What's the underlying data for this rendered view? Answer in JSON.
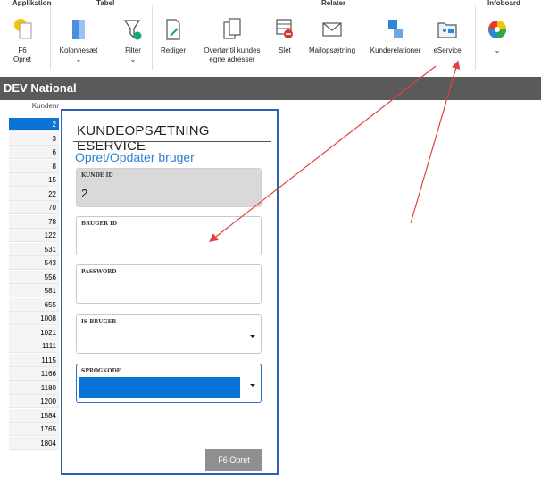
{
  "ribbon": {
    "groups": [
      "Applikation",
      "Tabel",
      "Relater",
      "Infoboard"
    ],
    "buttons": [
      {
        "label": "F6\nOpret",
        "icon": "lightbulb-icon"
      },
      {
        "label": "Kolonnesæt\n⌄",
        "icon": "columns-icon"
      },
      {
        "label": "Filter\n⌄",
        "icon": "filter-icon"
      },
      {
        "label": "Rediger",
        "icon": "edit-document-icon"
      },
      {
        "label": "Overfør til kundes\negne adresser",
        "icon": "copy-document-icon"
      },
      {
        "label": "Slet",
        "icon": "delete-table-icon"
      },
      {
        "label": "Mailopsætning",
        "icon": "envelope-icon"
      },
      {
        "label": "Kunderelationer",
        "icon": "relations-icon"
      },
      {
        "label": "eService",
        "icon": "eservice-folder-icon"
      },
      {
        "label": "⌄",
        "icon": "color-wheel-icon"
      }
    ]
  },
  "titlebar": {
    "title": "DEV National"
  },
  "grid": {
    "column_header": "Kundenr",
    "rows": [
      "2",
      "3",
      "6",
      "8",
      "15",
      "22",
      "70",
      "78",
      "122",
      "531",
      "543",
      "556",
      "581",
      "655",
      "1008",
      "1021",
      "1111",
      "1115",
      "1166",
      "1180",
      "1200",
      "1584",
      "1765",
      "1804"
    ]
  },
  "dialog": {
    "title": "KUNDEOPSÆTNING ESERVICE",
    "subtitle": "Opret/Opdater bruger",
    "fields": {
      "kunde_id": {
        "label": "KUNDE ID",
        "value": "2"
      },
      "bruger_id": {
        "label": "BRUGER ID",
        "value": ""
      },
      "password": {
        "label": "PASSWORD",
        "value": ""
      },
      "is_bruger": {
        "label": "IS BRUGER",
        "value": ""
      },
      "sprogkode": {
        "label": "SPROGKODE",
        "value": ""
      }
    },
    "save_label": "F6 Opret"
  },
  "colors": {
    "accent": "#0a74d6",
    "dialog_border": "#2f5fae",
    "arrow": "#e04040"
  }
}
